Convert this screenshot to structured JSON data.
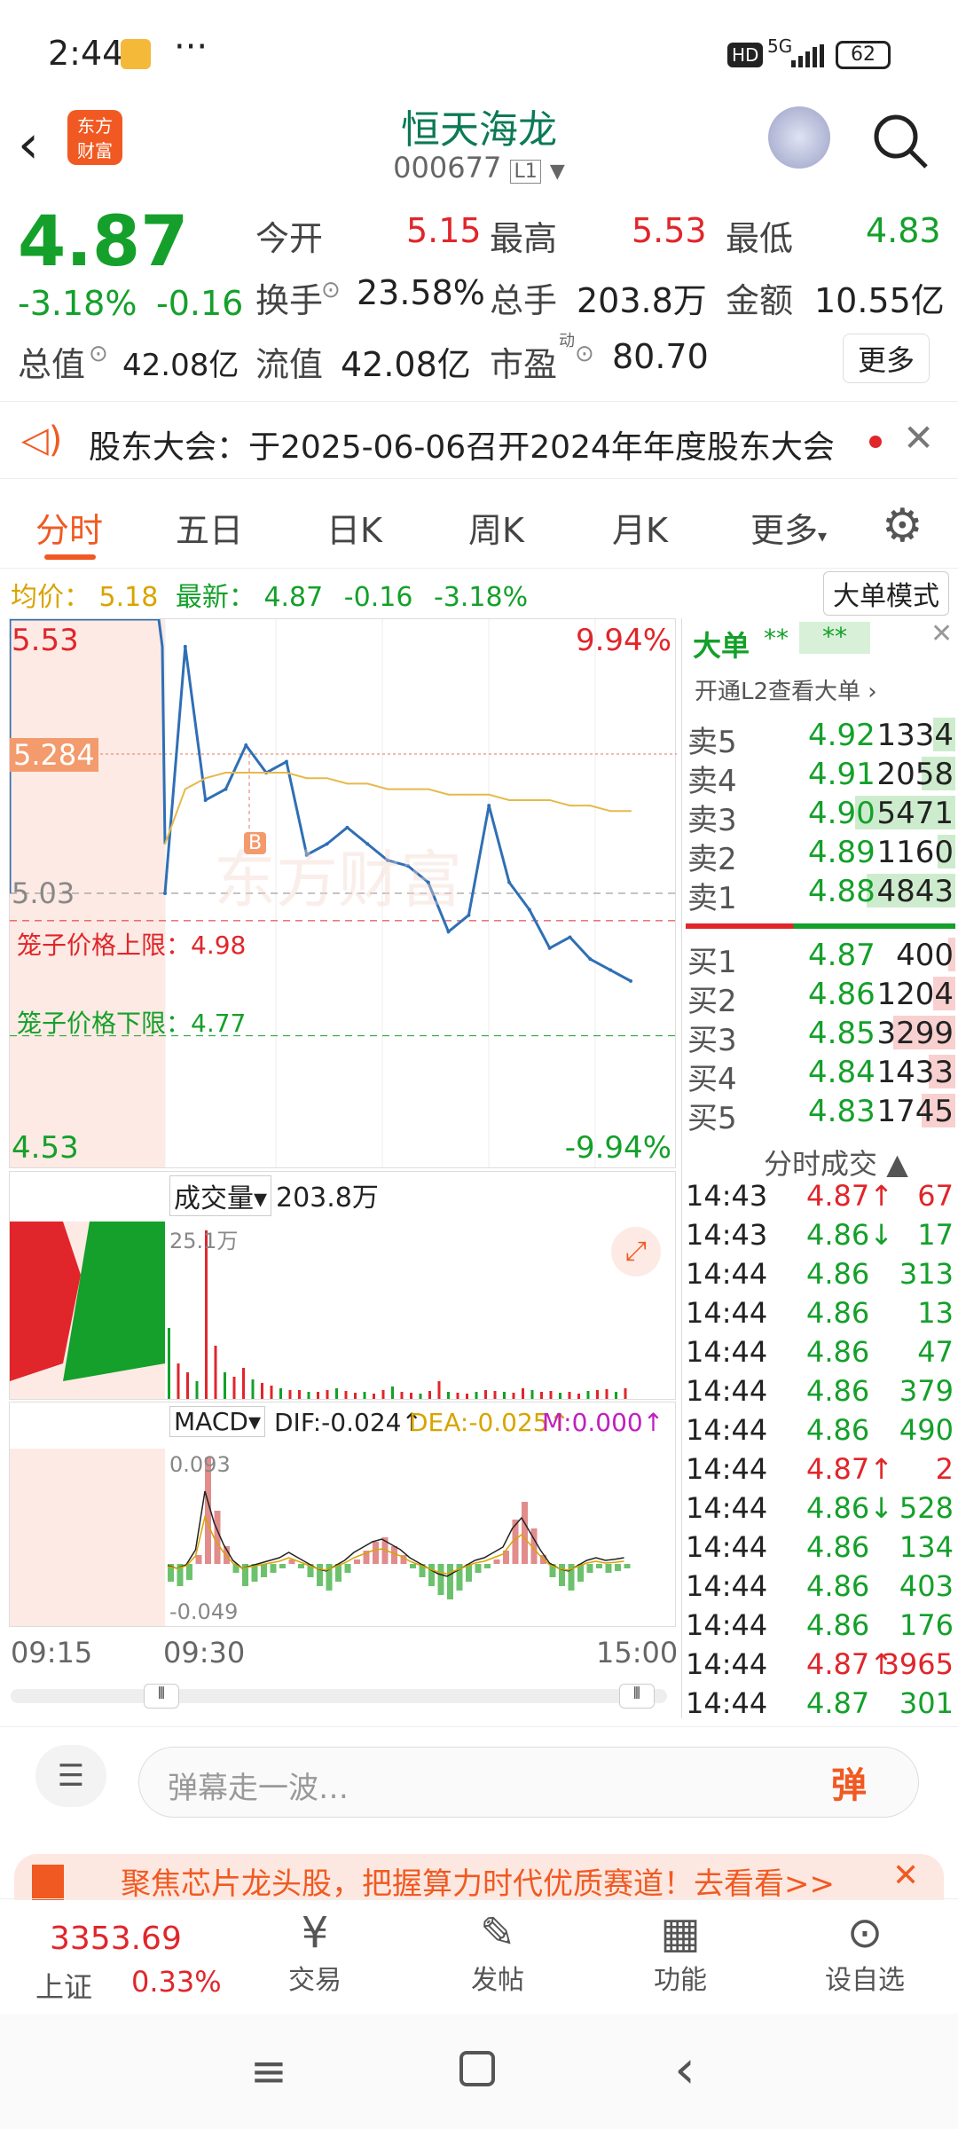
{
  "status": {
    "time": "2:44",
    "dots": "···",
    "hd": "HD",
    "signal": "5G",
    "battery": "62"
  },
  "header": {
    "title": "恒天海龙",
    "code": "000677",
    "level": "L1"
  },
  "quote": {
    "price": "4.87",
    "pct": "-3.18%",
    "chg": "-0.16",
    "open_label": "今开",
    "open": "5.15",
    "high_label": "最高",
    "high": "5.53",
    "low_label": "最低",
    "low": "4.83",
    "turnover_label": "换手",
    "turnover": "23.58%",
    "vol_label": "总手",
    "vol": "203.8万",
    "amount_label": "金额",
    "amount": "10.55亿",
    "mcap_label": "总值",
    "mcap": "42.08亿",
    "float_label": "流值",
    "float": "42.08亿",
    "pe_label": "市盈",
    "pe_sup": "动",
    "pe": "80.70",
    "more_btn": "更多"
  },
  "notice": {
    "text": "股东大会：于2025-06-06召开2024年年度股东大会"
  },
  "tabs": [
    "分时",
    "五日",
    "日K",
    "周K",
    "月K",
    "更多"
  ],
  "avgline": {
    "avg_label": "均价：",
    "avg": "5.18",
    "last_label": "最新：",
    "last": "4.87",
    "chg": "-0.16",
    "pct": "-3.18%",
    "big_mode": "大单模式"
  },
  "chart": {
    "top_price": "5.53",
    "top_pct": "9.94%",
    "bottom_price": "4.53",
    "bottom_pct": "-9.94%",
    "mark_price": "5.284",
    "prev_close": "5.03",
    "cage_upper": "笼子价格上限：4.98",
    "cage_lower": "笼子价格下限：4.77",
    "marker": "B",
    "watermark": "东方财富",
    "vol_label": "成交量",
    "vol_value": "203.8万",
    "vol_max": "25.1万",
    "macd_label": "MACD",
    "dif": "DIF:-0.024↑",
    "dea": "DEA:-0.025↑",
    "m": "M:0.000↑",
    "macd_max": "0.093",
    "macd_min": "-0.049",
    "t_start": "09:15",
    "t_open": "09:30",
    "t_end": "15:00"
  },
  "chart_data": {
    "type": "line",
    "x": [
      "09:30",
      "09:40",
      "09:50",
      "10:00",
      "10:10",
      "10:20",
      "10:30",
      "10:40",
      "10:50",
      "11:00",
      "11:10",
      "11:20",
      "11:30",
      "13:10",
      "13:20",
      "13:30",
      "13:40",
      "13:50",
      "14:00",
      "14:10",
      "14:20",
      "14:30",
      "14:40",
      "14:44"
    ],
    "series": [
      {
        "values": [
          5.03,
          5.48,
          5.2,
          5.22,
          5.3,
          5.25,
          5.27,
          5.1,
          5.12,
          5.15,
          5.12,
          5.09,
          5.08,
          5.05,
          4.96,
          4.99,
          5.19,
          5.05,
          5.0,
          4.93,
          4.95,
          4.91,
          4.89,
          4.87
        ]
      },
      {
        "values": [
          5.12,
          5.22,
          5.24,
          5.25,
          5.25,
          5.25,
          5.25,
          5.24,
          5.24,
          5.23,
          5.23,
          5.22,
          5.22,
          5.22,
          5.21,
          5.21,
          5.21,
          5.2,
          5.2,
          5.2,
          5.19,
          5.19,
          5.18,
          5.18
        ]
      }
    ],
    "ylim": [
      4.53,
      5.53
    ]
  },
  "orderbook": {
    "title": "大单",
    "stars": "**",
    "stars2": "**",
    "l2": "开通L2查看大单 ›",
    "asks": [
      {
        "label": "卖5",
        "price": "4.92",
        "vol": "1334",
        "fill": 0.1
      },
      {
        "label": "卖4",
        "price": "4.91",
        "vol": "2058",
        "fill": 0.15
      },
      {
        "label": "卖3",
        "price": "4.90",
        "vol": "5471",
        "fill": 0.45
      },
      {
        "label": "卖2",
        "price": "4.89",
        "vol": "1160",
        "fill": 0.08
      },
      {
        "label": "卖1",
        "price": "4.88",
        "vol": "4843",
        "fill": 0.4
      }
    ],
    "bids": [
      {
        "label": "买1",
        "price": "4.87",
        "vol": "400",
        "fill": 0.03
      },
      {
        "label": "买2",
        "price": "4.86",
        "vol": "1204",
        "fill": 0.1
      },
      {
        "label": "买3",
        "price": "4.85",
        "vol": "3299",
        "fill": 0.28
      },
      {
        "label": "买4",
        "price": "4.84",
        "vol": "1433",
        "fill": 0.12
      },
      {
        "label": "买5",
        "price": "4.83",
        "vol": "1745",
        "fill": 0.15
      }
    ],
    "ticks_title": "分时成交",
    "ticks": [
      {
        "t": "14:43",
        "p": "4.87",
        "d": "↑",
        "v": "67",
        "c": "red"
      },
      {
        "t": "14:43",
        "p": "4.86",
        "d": "↓",
        "v": "17",
        "c": "green"
      },
      {
        "t": "14:44",
        "p": "4.86",
        "d": "",
        "v": "313",
        "c": "green"
      },
      {
        "t": "14:44",
        "p": "4.86",
        "d": "",
        "v": "13",
        "c": "green"
      },
      {
        "t": "14:44",
        "p": "4.86",
        "d": "",
        "v": "47",
        "c": "green"
      },
      {
        "t": "14:44",
        "p": "4.86",
        "d": "",
        "v": "379",
        "c": "green"
      },
      {
        "t": "14:44",
        "p": "4.86",
        "d": "",
        "v": "490",
        "c": "green"
      },
      {
        "t": "14:44",
        "p": "4.87",
        "d": "↑",
        "v": "2",
        "c": "red"
      },
      {
        "t": "14:44",
        "p": "4.86",
        "d": "↓",
        "v": "528",
        "c": "green"
      },
      {
        "t": "14:44",
        "p": "4.86",
        "d": "",
        "v": "134",
        "c": "green"
      },
      {
        "t": "14:44",
        "p": "4.86",
        "d": "",
        "v": "403",
        "c": "green"
      },
      {
        "t": "14:44",
        "p": "4.86",
        "d": "",
        "v": "176",
        "c": "green"
      },
      {
        "t": "14:44",
        "p": "4.87",
        "d": "↑",
        "v": "3965",
        "c": "red"
      },
      {
        "t": "14:44",
        "p": "4.87",
        "d": "",
        "v": "301",
        "c": "green"
      }
    ]
  },
  "comment": {
    "placeholder": "弹幕走一波…",
    "btn": "弹"
  },
  "banner": {
    "text": "聚焦芯片龙头股，把握算力时代优质赛道！去看看>>"
  },
  "bottom": {
    "index_value": "3353.69",
    "index_name": "上证",
    "index_pct": "0.33%",
    "items": [
      "交易",
      "发帖",
      "功能",
      "设自选"
    ]
  }
}
